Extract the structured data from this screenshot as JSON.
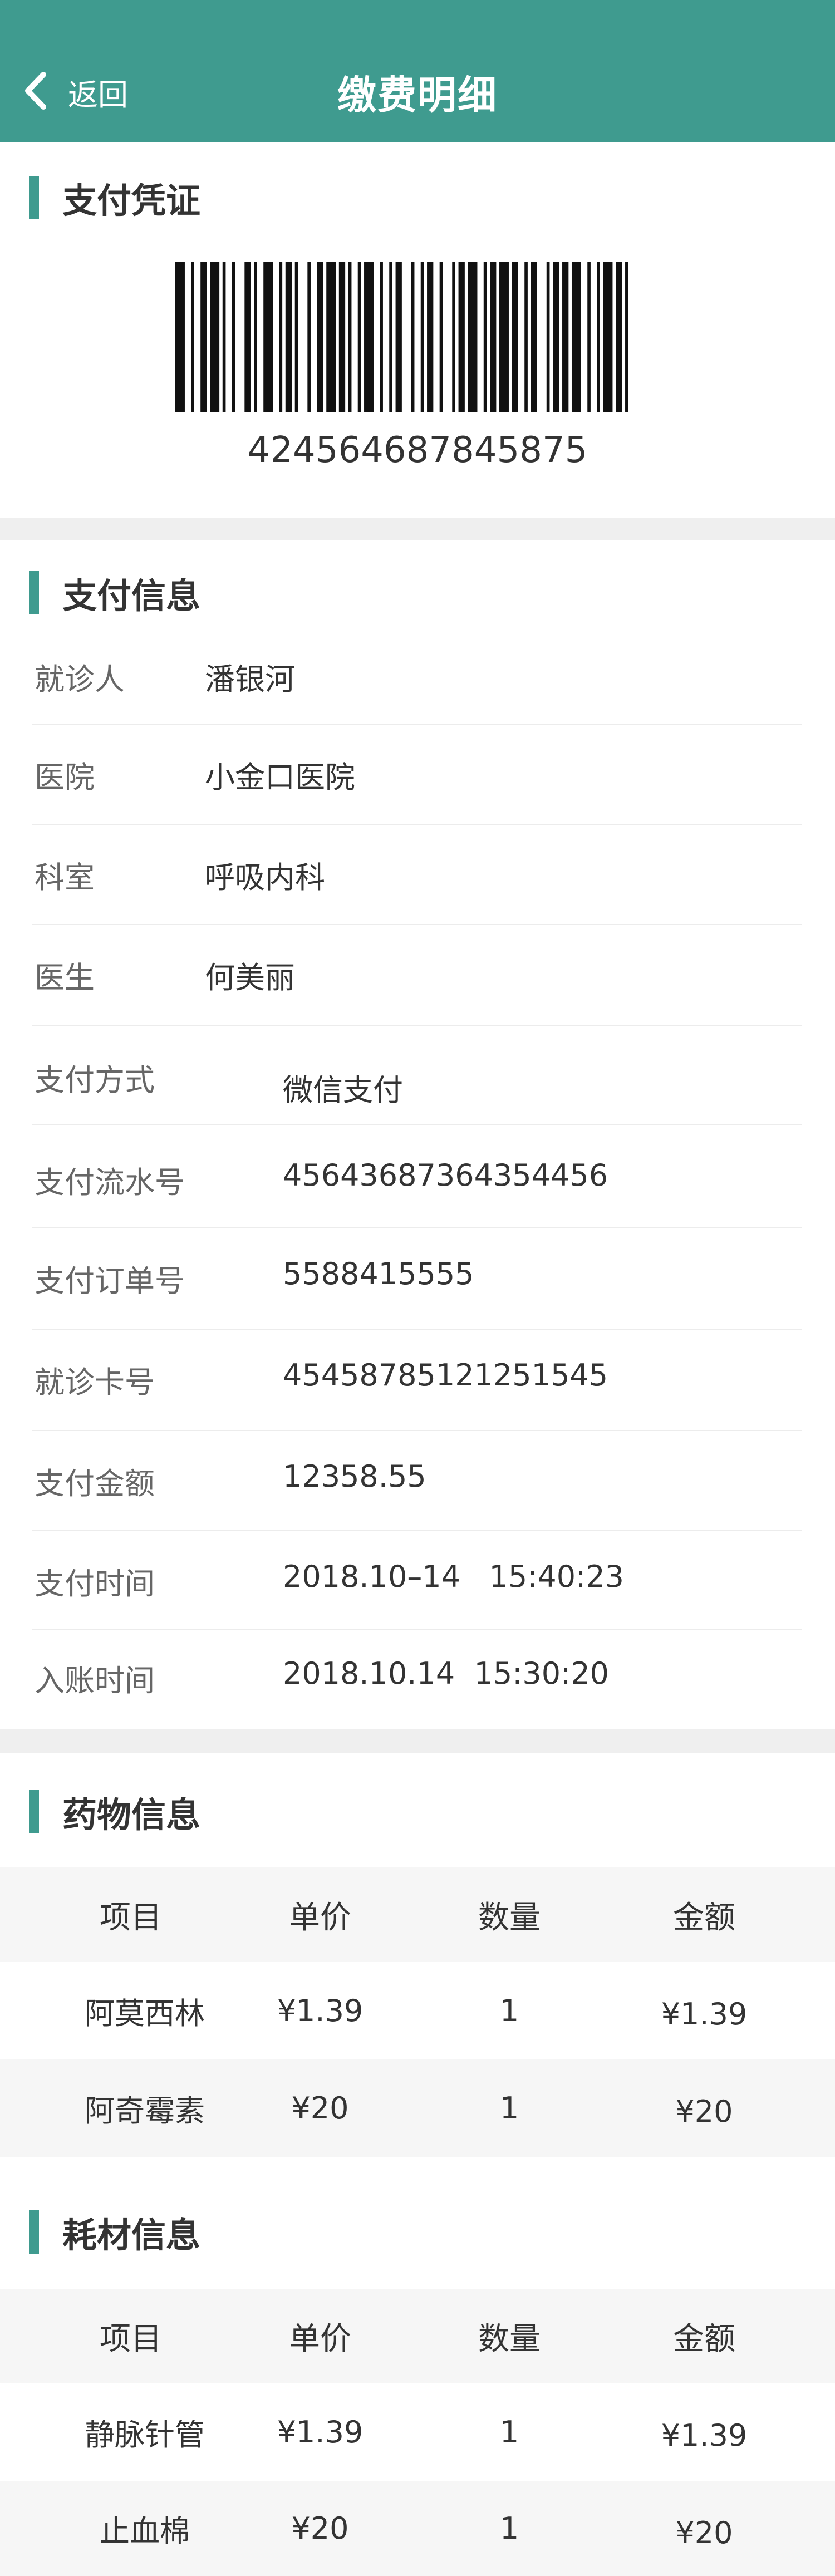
{
  "header": {
    "back_label": "返回",
    "title": "缴费明细",
    "bg_color": "#3f9b8f"
  },
  "voucher": {
    "title": "支付凭证",
    "barcode_number": "424564687845875"
  },
  "payment": {
    "title": "支付信息",
    "rows": [
      {
        "key": "就诊人",
        "value": "潘银河"
      },
      {
        "key": "医院",
        "value": "小金口医院"
      },
      {
        "key": "科室",
        "value": "呼吸内科"
      },
      {
        "key": "医生",
        "value": "何美丽"
      },
      {
        "key": "支付方式",
        "value": "微信支付"
      },
      {
        "key": "支付流水号",
        "value": "45643687364354456"
      },
      {
        "key": "支付订单号",
        "value": "5588415555"
      },
      {
        "key": "就诊卡号",
        "value": "45458785121251545"
      },
      {
        "key": "支付金额",
        "value": "12358.55"
      },
      {
        "key": "支付时间",
        "value": "2018.10–14   15:40:23"
      },
      {
        "key": "入账时间",
        "value": "2018.10.14  15:30:20"
      }
    ]
  },
  "drugs": {
    "title": "药物信息",
    "columns": [
      "项目",
      "单价",
      "数量",
      "金额"
    ],
    "rows": [
      [
        "阿莫西林",
        "¥1.39",
        "1",
        "¥1.39"
      ],
      [
        "阿奇霉素",
        "¥20",
        "1",
        "¥20"
      ]
    ]
  },
  "consumables": {
    "title": "耗材信息",
    "columns": [
      "项目",
      "单价",
      "数量",
      "金额"
    ],
    "rows": [
      [
        "静脉针管",
        "¥1.39",
        "1",
        "¥1.39"
      ],
      [
        "止血棉",
        "¥20",
        "1",
        "¥20"
      ]
    ]
  }
}
